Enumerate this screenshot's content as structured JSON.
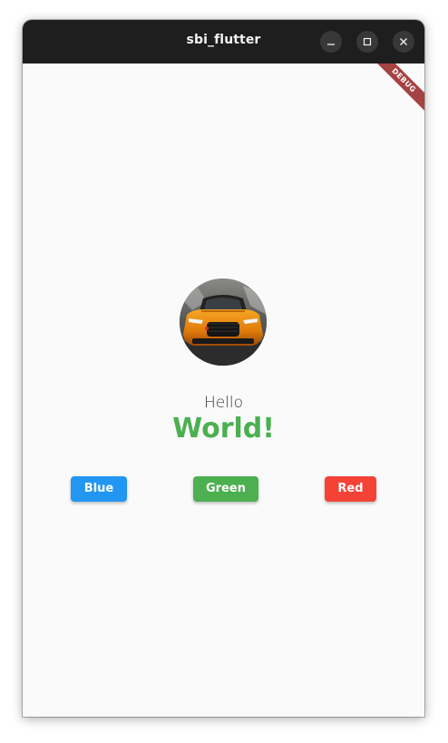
{
  "window": {
    "title": "sbi_flutter"
  },
  "debug_banner": {
    "label": "DEBUG"
  },
  "avatar": {
    "icon": "car-photo"
  },
  "greeting": {
    "hello": "Hello",
    "world": "World!",
    "world_color": "#4caf50"
  },
  "buttons": [
    {
      "label": "Blue",
      "color": "#2196f3"
    },
    {
      "label": "Green",
      "color": "#4caf50"
    },
    {
      "label": "Red",
      "color": "#f44336"
    }
  ]
}
